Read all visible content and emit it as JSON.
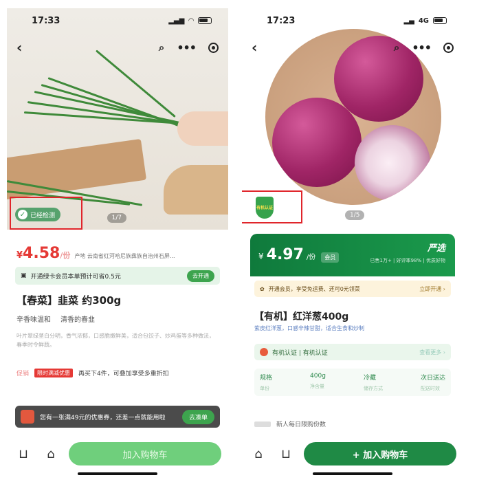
{
  "left": {
    "status": {
      "time": "17:33"
    },
    "gallery": {
      "pager": "1/7",
      "badge": "已经检测"
    },
    "price": {
      "currency": "¥",
      "value": "4.58",
      "unit": "/份"
    },
    "origin": "产地 云南省红河哈尼族彝族自治州石屏...",
    "vip": {
      "text": "开通绿卡会员本单预计可省0.5元",
      "button": "去开通"
    },
    "title": "【春菜】韭菜 约300g",
    "tags": [
      "辛香味温和",
      "清香的春韭"
    ],
    "desc": "叶片翠绿茎白分明，香气浓郁，口感脆嫩鲜美，适合包饺子、炒鸡蛋等多种做法，春季时令鲜蔬。",
    "promo": {
      "label": "促销",
      "tag": "限时满减优惠",
      "text": "再买下4件，可叠加享受多重折扣"
    },
    "toast": {
      "text": "您有一张满49元的优惠券，还差一点就能用啦",
      "button": "去凑单"
    },
    "cart_button": "加入购物车"
  },
  "right": {
    "status": {
      "time": "17:23",
      "network": "4G"
    },
    "gallery": {
      "pager": "1/5",
      "badge": "有机认证"
    },
    "price": {
      "currency": "¥",
      "value": "4.97",
      "unit": "/份",
      "chip": "会员"
    },
    "brand": "严选",
    "price_sub": "已售1万+ | 好评率98% | 优质好物",
    "vip": {
      "text": "开通会员，享受免运费、还可0元领菜",
      "action": "立即开通 ›"
    },
    "title": "【有机】红洋葱400g",
    "desc": "紫皮红洋葱，口感辛辣甘甜，适合生食和炒制",
    "cert": {
      "text": "有机认证 | 有机认证",
      "more": "查看更多 ›"
    },
    "specs": [
      {
        "k": "规格",
        "v": "单份"
      },
      {
        "k": "400g",
        "v": "净含量"
      },
      {
        "k": "冷藏",
        "v": "储存方式"
      },
      {
        "k": "次日送达",
        "v": "配送时效"
      }
    ],
    "member_note": "新人每日限购份数",
    "cart_button": "+ 加入购物车"
  }
}
